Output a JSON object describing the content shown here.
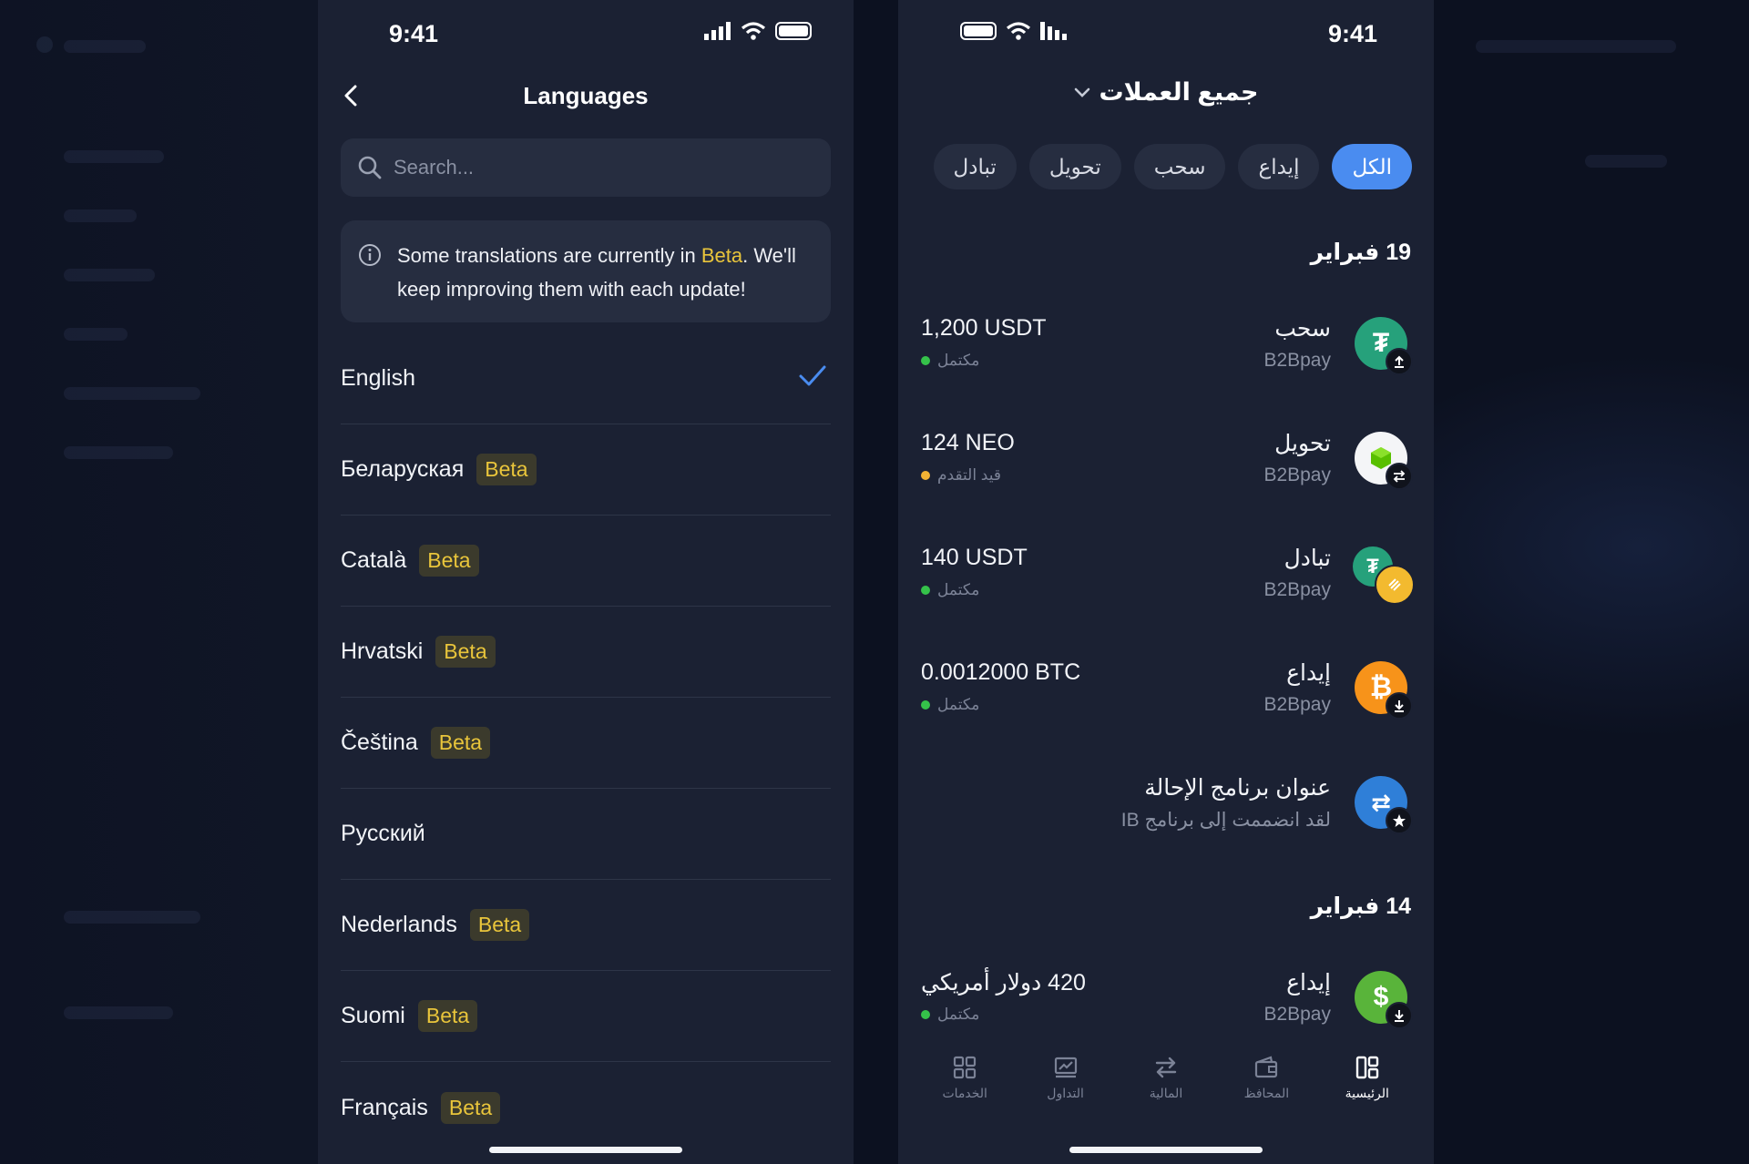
{
  "left_phone": {
    "status_time": "9:41",
    "title": "Languages",
    "search_placeholder": "Search...",
    "info": {
      "text_before": "Some translations are currently in ",
      "beta_word": "Beta",
      "text_after": ". We'll keep improving them with each update!"
    },
    "languages": [
      {
        "name": "English",
        "beta": "",
        "selected": true
      },
      {
        "name": "Беларуская",
        "beta": "Beta"
      },
      {
        "name": "Català",
        "beta": "Beta"
      },
      {
        "name": "Hrvatski",
        "beta": "Beta"
      },
      {
        "name": "Čeština",
        "beta": "Beta"
      },
      {
        "name": "Русский",
        "beta": ""
      },
      {
        "name": "Nederlands",
        "beta": "Beta"
      },
      {
        "name": "Suomi",
        "beta": "Beta"
      },
      {
        "name": "Français",
        "beta": "Beta"
      }
    ]
  },
  "right_phone": {
    "status_time": "9:41",
    "title": "جميع العملات",
    "filters": [
      "الكل",
      "إيداع",
      "سحب",
      "تحويل",
      "تبادل"
    ],
    "active_filter": "الكل",
    "groups": [
      {
        "date": "19 فبراير",
        "transactions": [
          {
            "type": "سحب",
            "provider": "B2Bpay",
            "amount": "1,200 USDT",
            "status": "مكتمل",
            "status_color": "#35c24a",
            "coin": "USDT",
            "coin_color": "#26a17b",
            "coin_glyph": "₮",
            "badge_icon": "upload-icon"
          },
          {
            "type": "تحويل",
            "provider": "B2Bpay",
            "amount": "124 NEO",
            "status": "قيد التقدم",
            "status_color": "#f2b234",
            "coin": "NEO",
            "coin_color": "#f4f5f7",
            "coin_glyph": "◆",
            "badge_icon": "swap-icon"
          },
          {
            "type": "تبادل",
            "provider": "B2Bpay",
            "amount": "140 USDT",
            "status": "مكتمل",
            "status_color": "#35c24a",
            "coin": "USDT",
            "coin_color": "#26a17b",
            "coin_glyph": "₮",
            "badge_icon": "bnb-icon"
          },
          {
            "type": "إيداع",
            "provider": "B2Bpay",
            "amount": "0.0012000 BTC",
            "status": "مكتمل",
            "status_color": "#35c24a",
            "coin": "BTC",
            "coin_color": "#f7931a",
            "coin_glyph": "₿",
            "badge_icon": "download-icon"
          },
          {
            "type": "عنوان برنامج الإحالة",
            "provider": "لقد انضممت إلى برنامج IB",
            "amount": "",
            "status": "",
            "status_color": "",
            "coin": "IB",
            "coin_color": "#2f7fd8",
            "coin_glyph": "⇄",
            "badge_icon": "star-icon"
          }
        ]
      },
      {
        "date": "14 فبراير",
        "transactions": [
          {
            "type": "إيداع",
            "provider": "B2Bpay",
            "amount": "420 دولار أمريكي",
            "status": "مكتمل",
            "status_color": "#35c24a",
            "coin": "USD",
            "coin_color": "#59b43a",
            "coin_glyph": "$",
            "badge_icon": "download-icon"
          }
        ]
      }
    ],
    "tabbar": [
      {
        "label": "الرئيسية",
        "icon": "dashboard-icon",
        "active": true
      },
      {
        "label": "المحافظ",
        "icon": "wallet-icon"
      },
      {
        "label": "المالية",
        "icon": "transfer-icon"
      },
      {
        "label": "التداول",
        "icon": "chart-icon"
      },
      {
        "label": "الخدمات",
        "icon": "grid-icon"
      }
    ]
  }
}
